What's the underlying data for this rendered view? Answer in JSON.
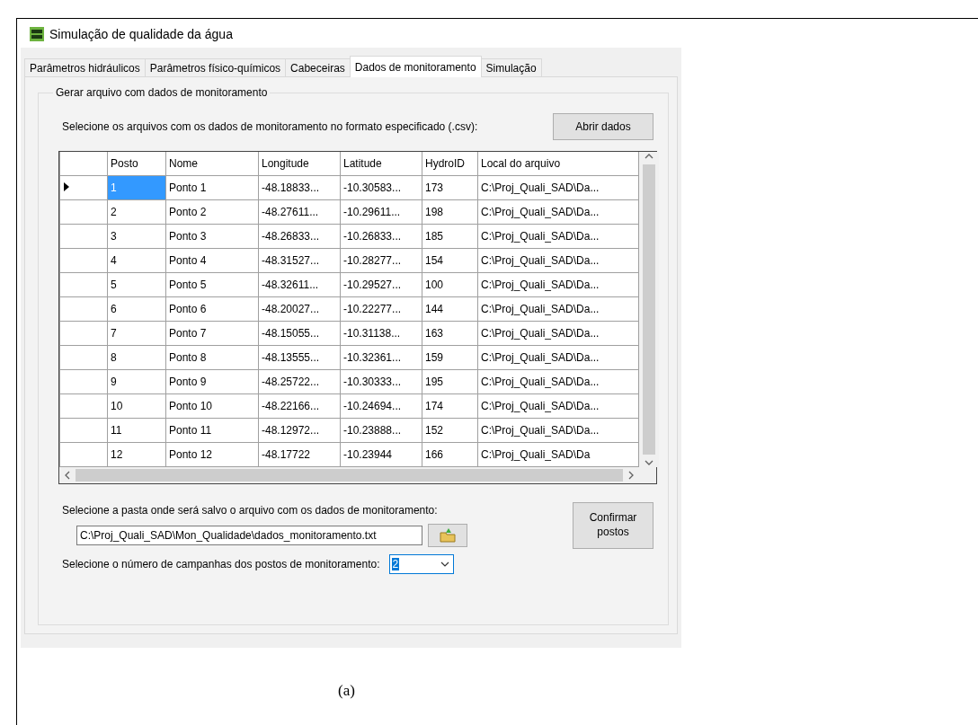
{
  "window": {
    "title": "Simulação de qualidade da água"
  },
  "tabs": [
    {
      "label": "Parâmetros hidráulicos",
      "selected": false
    },
    {
      "label": "Parâmetros físico-químicos",
      "selected": false
    },
    {
      "label": "Cabeceiras",
      "selected": false
    },
    {
      "label": "Dados de monitoramento",
      "selected": true
    },
    {
      "label": "Simulação",
      "selected": false
    }
  ],
  "group": {
    "title": "Gerar arquivo com dados de monitoramento",
    "select_files_label": "Selecione os arquivos com os dados de monitoramento no formato especificado (.csv):",
    "open_button": "Abrir dados",
    "table": {
      "columns": [
        "Posto",
        "Nome",
        "Longitude",
        "Latitude",
        "HydroID",
        "Local do arquivo"
      ],
      "rows": [
        {
          "selected": true,
          "cells": [
            "1",
            "Ponto 1",
            "-48.18833...",
            "-10.30583...",
            "173",
            "C:\\Proj_Quali_SAD\\Da..."
          ]
        },
        {
          "selected": false,
          "cells": [
            "2",
            "Ponto 2",
            "-48.27611...",
            "-10.29611...",
            "198",
            "C:\\Proj_Quali_SAD\\Da..."
          ]
        },
        {
          "selected": false,
          "cells": [
            "3",
            "Ponto 3",
            "-48.26833...",
            "-10.26833...",
            "185",
            "C:\\Proj_Quali_SAD\\Da..."
          ]
        },
        {
          "selected": false,
          "cells": [
            "4",
            "Ponto 4",
            "-48.31527...",
            "-10.28277...",
            "154",
            "C:\\Proj_Quali_SAD\\Da..."
          ]
        },
        {
          "selected": false,
          "cells": [
            "5",
            "Ponto 5",
            "-48.32611...",
            "-10.29527...",
            "100",
            "C:\\Proj_Quali_SAD\\Da..."
          ]
        },
        {
          "selected": false,
          "cells": [
            "6",
            "Ponto 6",
            "-48.20027...",
            "-10.22277...",
            "144",
            "C:\\Proj_Quali_SAD\\Da..."
          ]
        },
        {
          "selected": false,
          "cells": [
            "7",
            "Ponto 7",
            "-48.15055...",
            "-10.31138...",
            "163",
            "C:\\Proj_Quali_SAD\\Da..."
          ]
        },
        {
          "selected": false,
          "cells": [
            "8",
            "Ponto 8",
            "-48.13555...",
            "-10.32361...",
            "159",
            "C:\\Proj_Quali_SAD\\Da..."
          ]
        },
        {
          "selected": false,
          "cells": [
            "9",
            "Ponto 9",
            "-48.25722...",
            "-10.30333...",
            "195",
            "C:\\Proj_Quali_SAD\\Da..."
          ]
        },
        {
          "selected": false,
          "cells": [
            "10",
            "Ponto 10",
            "-48.22166...",
            "-10.24694...",
            "174",
            "C:\\Proj_Quali_SAD\\Da..."
          ]
        },
        {
          "selected": false,
          "cells": [
            "11",
            "Ponto 11",
            "-48.12972...",
            "-10.23888...",
            "152",
            "C:\\Proj_Quali_SAD\\Da..."
          ]
        },
        {
          "selected": false,
          "cells": [
            "12",
            "Ponto 12",
            "-48.17722",
            "-10.23944",
            "166",
            "C:\\Proj_Quali_SAD\\Da"
          ]
        }
      ]
    },
    "folder_label": "Selecione a pasta onde será salvo o arquivo com os dados de monitoramento:",
    "folder_path": "C:\\Proj_Quali_SAD\\Mon_Qualidade\\dados_monitoramento.txt",
    "campaigns_label": "Selecione o número de campanhas dos postos de monitoramento:",
    "campaigns_value": "2",
    "confirm_button": "Confirmar postos"
  },
  "caption": "(a)"
}
